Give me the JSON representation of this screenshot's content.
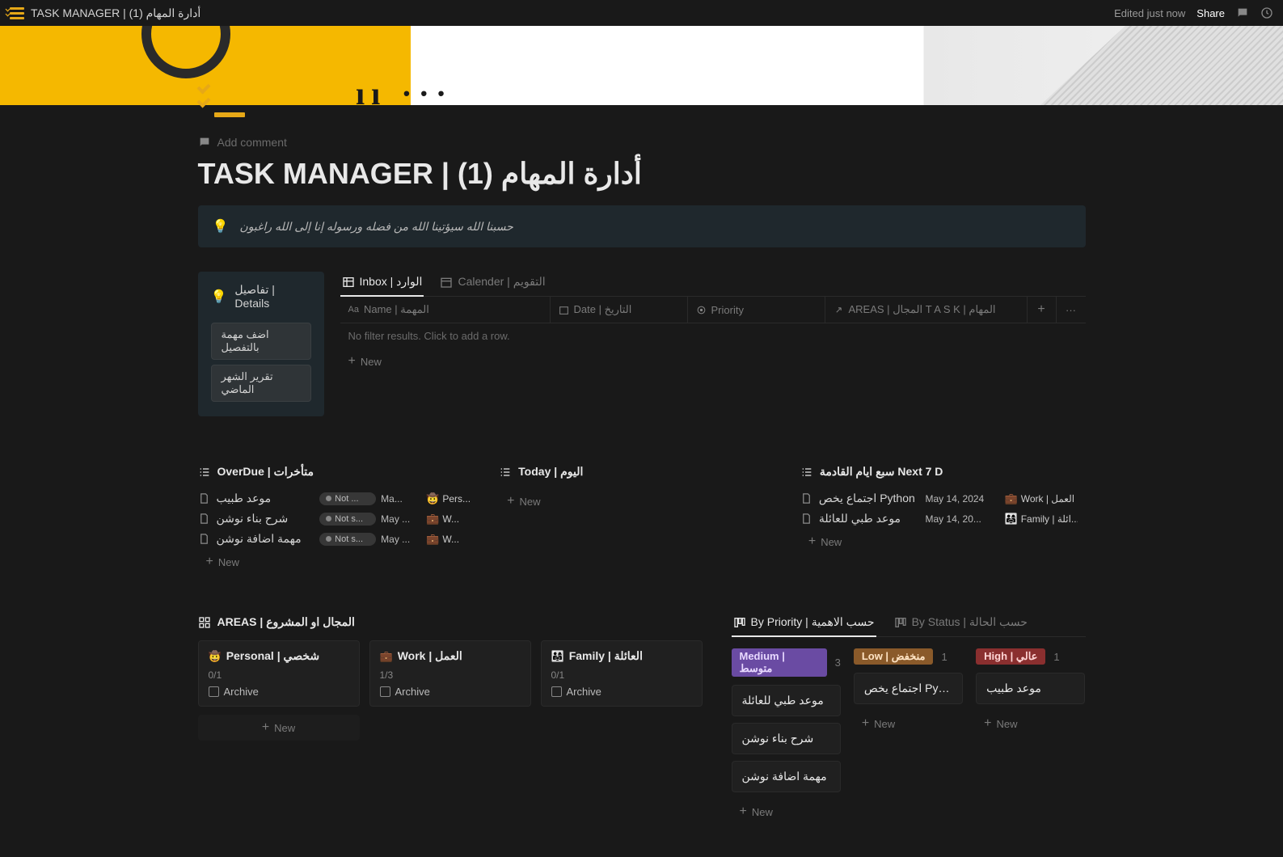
{
  "topbar": {
    "title": "TASK MANAGER | (1) أدارة المهام",
    "edited": "Edited just now",
    "share": "Share"
  },
  "page": {
    "add_comment": "Add comment",
    "title": "TASK MANAGER | (1) أدارة المهام",
    "callout": "حسبنا الله سيؤتينا الله من فضله ورسوله إنا إلى الله راغبون"
  },
  "details": {
    "heading": "تفاصيل | Details",
    "btn1": "اضف مهمة بالتفصيل",
    "btn2": "تقرير الشهر الماضي"
  },
  "inbox": {
    "tab1": "Inbox | الوارد",
    "tab2": "Calender | التقويم",
    "col_name": "Name | المهمة",
    "col_date": "Date | التاريخ",
    "col_priority": "Priority",
    "col_areas": "AREAS | المجال T A S K | المهام",
    "empty": "No filter results. Click to add a row.",
    "new": "New"
  },
  "overdue": {
    "title": "OverDue | متأخرات",
    "rows": [
      {
        "name": "موعد طبيب",
        "status": "Not ...",
        "date": "Ma...",
        "area_emoji": "🤠",
        "area": "Pers..."
      },
      {
        "name": "شرح بناء نوشن",
        "status": "Not s...",
        "date": "May ...",
        "area_emoji": "💼",
        "area": "W..."
      },
      {
        "name": "مهمة اضافة نوشن",
        "status": "Not s...",
        "date": "May ...",
        "area_emoji": "💼",
        "area": "W..."
      }
    ],
    "new": "New"
  },
  "today": {
    "title": "Today | اليوم",
    "new": "New"
  },
  "next7": {
    "title": "سبع ايام القادمة Next 7 D",
    "rows": [
      {
        "name": "اجتماع يخص Python",
        "date": "May 14, 2024",
        "area_emoji": "💼",
        "area": "Work | العمل"
      },
      {
        "name": "موعد طبي للعائلة",
        "date": "May 14, 20...",
        "area_emoji": "👨‍👩‍👧",
        "area": "Family | ائلة..."
      }
    ],
    "new": "New"
  },
  "areas": {
    "title": "AREAS | المجال او المشروع",
    "cards": [
      {
        "emoji": "🤠",
        "name": "Personal | شخصي",
        "count": "0/1",
        "archive": "Archive"
      },
      {
        "emoji": "💼",
        "name": "Work | العمل",
        "count": "1/3",
        "archive": "Archive"
      },
      {
        "emoji": "👨‍👩‍👧",
        "name": "Family | العائلة",
        "count": "0/1",
        "archive": "Archive"
      }
    ],
    "new": "New"
  },
  "priority": {
    "tab1": "By Priority | حسب الاهمية",
    "tab2": "By Status | حسب الحالة",
    "cols": [
      {
        "badge": "Medium | متوسط",
        "cls": "medium",
        "count": "3",
        "cards": [
          "موعد طبي للعائلة",
          "شرح بناء نوشن",
          "مهمة اضافة نوشن"
        ]
      },
      {
        "badge": "Low | منخفض",
        "cls": "low",
        "count": "1",
        "cards": [
          "اجتماع يخص Python"
        ]
      },
      {
        "badge": "High | عالي",
        "cls": "high",
        "count": "1",
        "cards": [
          "موعد طبيب"
        ]
      }
    ],
    "new": "New"
  }
}
